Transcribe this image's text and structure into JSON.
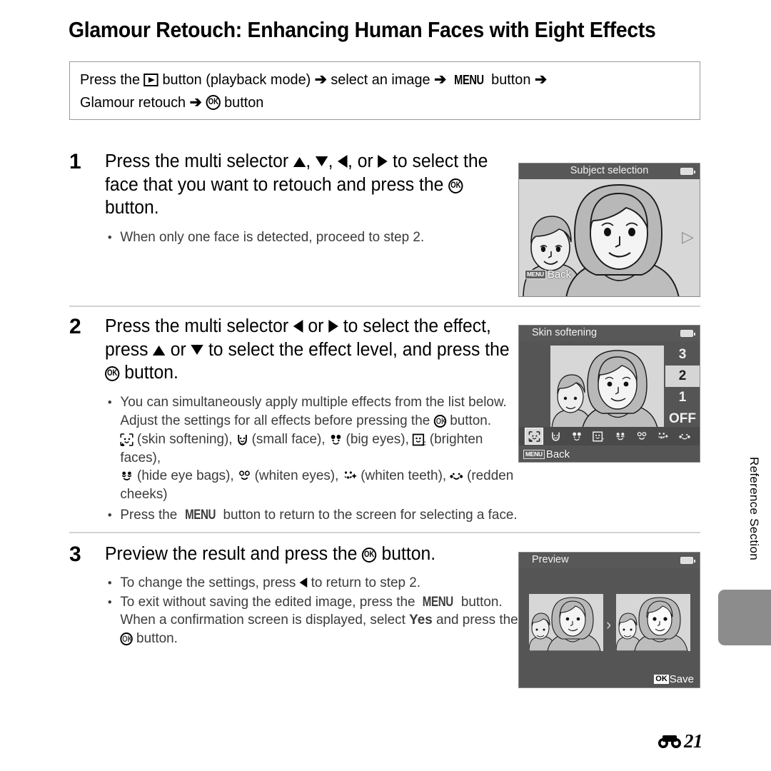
{
  "page": {
    "title": "Glamour Retouch: Enhancing Human Faces with Eight Effects",
    "page_number": "21",
    "page_prefix_icon": "reference-mark-icon",
    "side_tab_label": "Reference Section"
  },
  "intro": {
    "line1_a": "Press the",
    "line1_icon1": "playback-button-icon",
    "line1_b": "button (playback mode)",
    "arrow1": "➔",
    "line1_c": "select an image",
    "arrow2": "➔",
    "line1_menu": "MENU",
    "line1_d": "button",
    "arrow3": "➔",
    "line2_a": "Glamour retouch",
    "arrow4": "➔",
    "line2_icon": "ok-button-icon",
    "line2_b": "button"
  },
  "steps": [
    {
      "number": "1",
      "head_a": "Press the multi selector",
      "head_up": "up-triangle-icon",
      "head_sep1": ",",
      "head_down": "down-triangle-icon",
      "head_sep2": ",",
      "head_left": "left-triangle-icon",
      "head_sep3": ", or",
      "head_right": "right-triangle-icon",
      "head_b": "to select the face that you want to retouch and press the",
      "head_ok": "ok-button-icon",
      "head_c": "button.",
      "bullets": [
        {
          "text": "When only one face is detected, proceed to step 2."
        }
      ]
    },
    {
      "number": "2",
      "head_a": "Press the multi selector",
      "head_left": "left-triangle-icon",
      "head_or1": "or",
      "head_right": "right-triangle-icon",
      "head_b": "to select the effect, press",
      "head_up": "up-triangle-icon",
      "head_or2": "or",
      "head_down": "down-triangle-icon",
      "head_c": "to select the effect level, and press the",
      "head_ok": "ok-button-icon",
      "head_d": "button.",
      "bullet1_a": "You can simultaneously apply multiple effects from the list below. Adjust the settings for all effects before pressing the",
      "bullet1_ok": "ok-button-icon",
      "bullet1_b": "button.",
      "effects": [
        {
          "icon": "skin-softening-icon",
          "label": "(skin softening),"
        },
        {
          "icon": "small-face-icon",
          "label": "(small face),"
        },
        {
          "icon": "big-eyes-icon",
          "label": "(big eyes),"
        },
        {
          "icon": "brighten-faces-icon",
          "label": "(brighten faces),"
        },
        {
          "icon": "hide-eye-bags-icon",
          "label": "(hide eye bags),"
        },
        {
          "icon": "whiten-eyes-icon",
          "label": "(whiten eyes),"
        },
        {
          "icon": "whiten-teeth-icon",
          "label": "(whiten teeth),"
        },
        {
          "icon": "redden-cheeks-icon",
          "label": "(redden cheeks)"
        }
      ],
      "bullet2_a": "Press the",
      "bullet2_menu": "MENU",
      "bullet2_b": "button to return to the screen for selecting a face."
    },
    {
      "number": "3",
      "head_a": "Preview the result and press the",
      "head_ok": "ok-button-icon",
      "head_b": "button.",
      "bullet1_a": "To change the settings, press",
      "bullet1_left": "left-triangle-icon",
      "bullet1_b": "to return to step 2.",
      "bullet2_a": "To exit without saving the edited image, press the",
      "bullet2_menu": "MENU",
      "bullet2_b": "button. When a confirmation screen is displayed, select",
      "bullet2_yes": "Yes",
      "bullet2_c": "and press the",
      "bullet2_ok": "ok-button-icon",
      "bullet2_d": "button."
    }
  ],
  "screens": [
    {
      "name": "subject-selection",
      "title": "Subject selection",
      "title_align": "center",
      "battery": "battery-icon",
      "nav_arrow": "right-arrow-icon",
      "back_chip": "MENU",
      "back_label": "Back"
    },
    {
      "name": "skin-softening",
      "title": "Skin softening",
      "title_align": "left",
      "battery": "battery-icon",
      "levels": [
        "3",
        "2",
        "1",
        "OFF"
      ],
      "selected_level": "2",
      "effect_icons": [
        "skin-softening-icon",
        "small-face-icon",
        "big-eyes-icon",
        "brighten-faces-icon",
        "hide-eye-bags-icon",
        "whiten-eyes-icon",
        "whiten-teeth-icon",
        "redden-cheeks-icon"
      ],
      "selected_effect_index": 0,
      "back_chip": "MENU",
      "back_label": "Back"
    },
    {
      "name": "preview",
      "title": "Preview",
      "title_align": "left",
      "battery": "battery-icon",
      "compare_arrow": "›",
      "ok_chip": "OK",
      "save_label": "Save"
    }
  ],
  "colors": {
    "screen_chrome": "#585858",
    "screen_body": "#555555",
    "photo_bg": "#d7d7d7",
    "selected_level_bg": "#d5d5d5",
    "rule": "#d2d2d2",
    "side_tab": "#8c8c8c"
  }
}
